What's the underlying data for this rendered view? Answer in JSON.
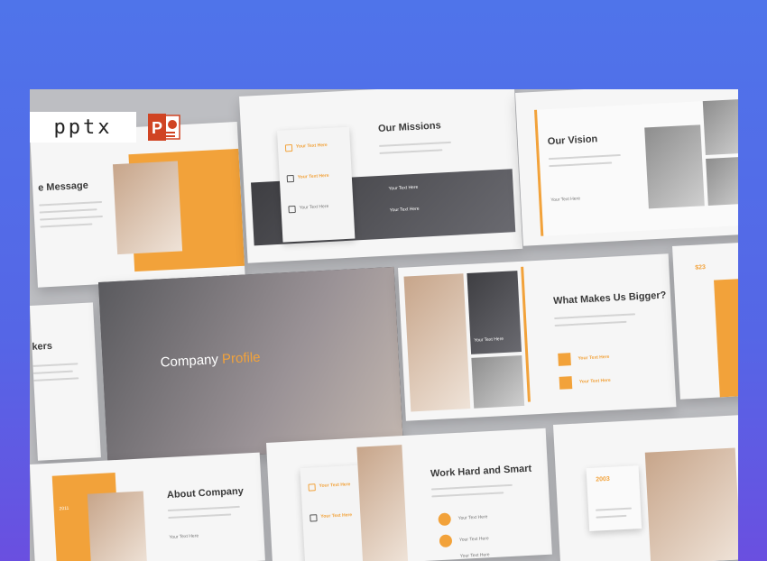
{
  "badge": {
    "label": "pptx",
    "icon": "powerpoint-icon"
  },
  "slides": {
    "message": {
      "title": "e Message"
    },
    "missions": {
      "title": "Our Missions",
      "items": [
        "Your Text Here",
        "Your Text Here",
        "Your Text Here"
      ],
      "overlay_items": [
        "Your Text Here",
        "Your Text Here"
      ]
    },
    "vision": {
      "title": "Our Vision",
      "label": "Your Text Here"
    },
    "speakers": {
      "title": "kers"
    },
    "company": {
      "title_a": "Company ",
      "title_b": "Profile"
    },
    "bigger": {
      "title": "What Makes Us Bigger?",
      "items": [
        "Your Text Here",
        "Your Text Here"
      ],
      "caption": "Your Text Here"
    },
    "stat": {
      "value": "$23"
    },
    "about": {
      "title": "About Company",
      "year": "2011",
      "label": "Your Text Here"
    },
    "work": {
      "title": "Work Hard and Smart",
      "items": [
        "Your Text Here",
        "Your Text Here",
        "Your Text Here"
      ],
      "side_items": [
        "Your Text Here",
        "Your Text Here"
      ]
    },
    "year2003": {
      "value": "2003"
    }
  },
  "colors": {
    "accent": "#f2a23a",
    "background": "#4f74ea",
    "canvas": "#bdbec2"
  }
}
